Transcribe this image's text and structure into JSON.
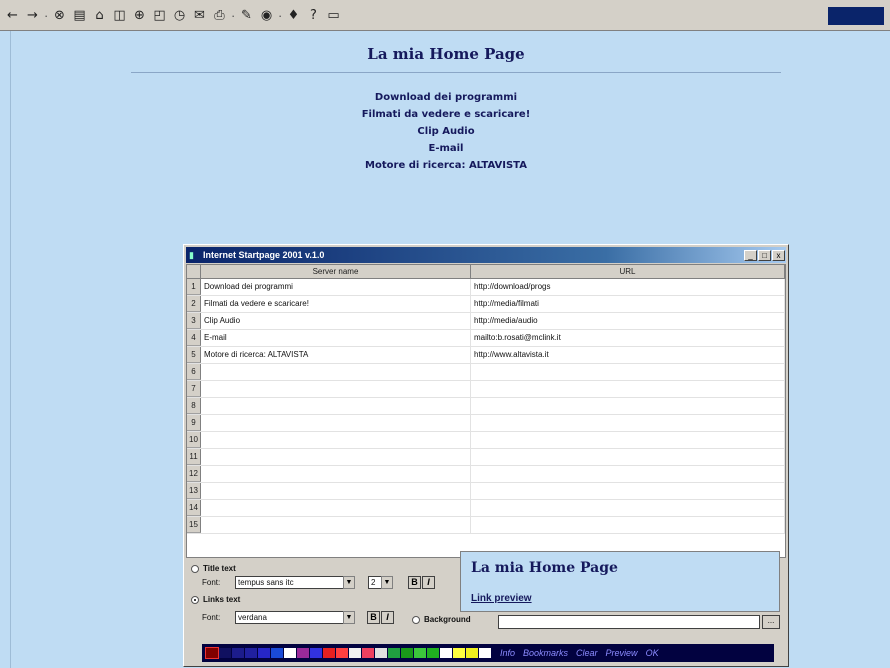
{
  "toolbar": {
    "icons": [
      "back-icon",
      "forward-icon",
      "stop-icon",
      "refresh-icon",
      "home-icon",
      "view-icon",
      "search-icon",
      "favorites-icon",
      "history-icon",
      "mail-icon",
      "print-icon",
      "edit-icon",
      "discuss-icon",
      "messenger-icon",
      "help-icon",
      "window-icon"
    ],
    "glyphs": [
      "←",
      "→",
      "⊗",
      "▤",
      "⌂",
      "◫",
      "⊕",
      "◰",
      "◷",
      "✉",
      "⎙",
      "✎",
      "◉",
      "♦",
      "?",
      "▭"
    ]
  },
  "page": {
    "title": "La mia Home Page",
    "links": [
      "Download dei programmi",
      "Filmati da vedere e scaricare!",
      "Clip Audio",
      "E-mail",
      "Motore di ricerca: ALTAVISTA"
    ]
  },
  "window": {
    "title": "Internet Startpage 2001 v.1.0",
    "minimize": "_",
    "maximize": "□",
    "close": "x",
    "columns": [
      "Server name",
      "URL"
    ],
    "rows": [
      {
        "num": "1",
        "name": "Download dei programmi",
        "url": "http://download/progs"
      },
      {
        "num": "2",
        "name": "Filmati da vedere e scaricare!",
        "url": "http://media/filmati"
      },
      {
        "num": "3",
        "name": "Clip Audio",
        "url": "http://media/audio"
      },
      {
        "num": "4",
        "name": "E-mail",
        "url": "mailto:b.rosati@mclink.it"
      },
      {
        "num": "5",
        "name": "Motore di ricerca: ALTAVISTA",
        "url": "http://www.altavista.it"
      },
      {
        "num": "6",
        "name": "",
        "url": ""
      },
      {
        "num": "7",
        "name": "",
        "url": ""
      },
      {
        "num": "8",
        "name": "",
        "url": ""
      },
      {
        "num": "9",
        "name": "",
        "url": ""
      },
      {
        "num": "10",
        "name": "",
        "url": ""
      },
      {
        "num": "11",
        "name": "",
        "url": ""
      },
      {
        "num": "12",
        "name": "",
        "url": ""
      },
      {
        "num": "13",
        "name": "",
        "url": ""
      },
      {
        "num": "14",
        "name": "",
        "url": ""
      },
      {
        "num": "15",
        "name": "",
        "url": ""
      }
    ],
    "title_text": {
      "label": "Title text",
      "font_label": "Font:",
      "font": "tempus sans itc",
      "size": "2",
      "bold": "B",
      "italic": "I"
    },
    "links_text": {
      "label": "Links text",
      "font_label": "Font:",
      "font": "verdana",
      "bold": "B",
      "italic": "I"
    },
    "background": {
      "label": "Background",
      "value": ""
    },
    "browse": "...",
    "preview": {
      "title": "La mia Home Page",
      "link": "Link preview"
    },
    "palette": [
      "#800000",
      "#101060",
      "#1c1c8c",
      "#2020a0",
      "#2626c8",
      "#1a4ad8",
      "#ffffff",
      "#9a2a9a",
      "#3232e0",
      "#e62020",
      "#ff4040",
      "#f0f0f0",
      "#f04060",
      "#e0e0e0",
      "#20a040",
      "#1a9a1a",
      "#3cc83c",
      "#20b020",
      "#ffffff",
      "#ffff40",
      "#f0f020",
      "#ffffff"
    ],
    "buttons": [
      "Info",
      "Bookmarks",
      "Clear",
      "Preview",
      "OK"
    ]
  }
}
